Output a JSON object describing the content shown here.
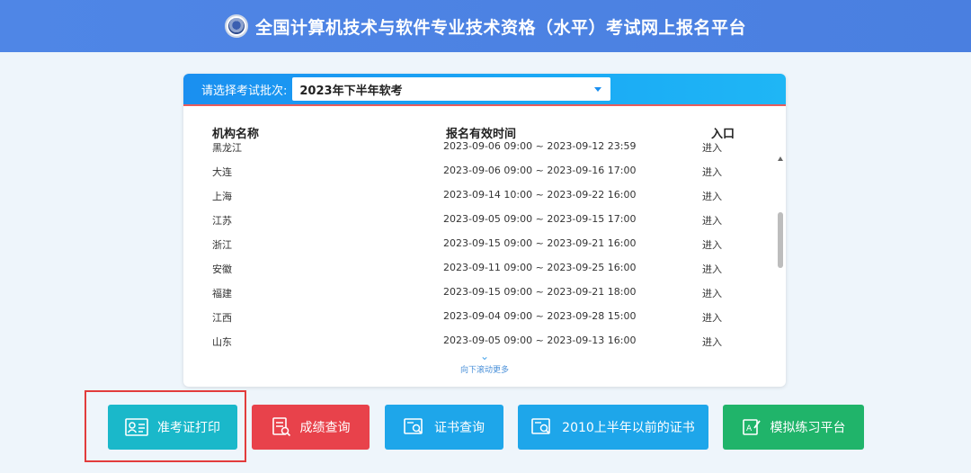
{
  "header": {
    "title": "全国计算机技术与软件专业技术资格（水平）考试网上报名平台"
  },
  "batch": {
    "label": "请选择考试批次:",
    "selected": "2023年下半年软考"
  },
  "table": {
    "headers": [
      "机构名称",
      "报名有效时间",
      "入口"
    ],
    "rows": [
      {
        "name": "黑龙江",
        "time": "2023-09-06 09:00 ~ 2023-09-12 23:59",
        "entry": "进入"
      },
      {
        "name": "大连",
        "time": "2023-09-06 09:00 ~ 2023-09-16 17:00",
        "entry": "进入"
      },
      {
        "name": "上海",
        "time": "2023-09-14 10:00 ~ 2023-09-22 16:00",
        "entry": "进入"
      },
      {
        "name": "江苏",
        "time": "2023-09-05 09:00 ~ 2023-09-15 17:00",
        "entry": "进入"
      },
      {
        "name": "浙江",
        "time": "2023-09-15 09:00 ~ 2023-09-21 16:00",
        "entry": "进入"
      },
      {
        "name": "安徽",
        "time": "2023-09-11 09:00 ~ 2023-09-25 16:00",
        "entry": "进入"
      },
      {
        "name": "福建",
        "time": "2023-09-15 09:00 ~ 2023-09-21 18:00",
        "entry": "进入"
      },
      {
        "name": "江西",
        "time": "2023-09-04 09:00 ~ 2023-09-28 15:00",
        "entry": "进入"
      },
      {
        "name": "山东",
        "time": "2023-09-05 09:00 ~ 2023-09-13 16:00",
        "entry": "进入"
      }
    ]
  },
  "scroll_more": "向下滚动更多",
  "buttons": {
    "admission": "准考证打印",
    "score": "成绩查询",
    "cert": "证书查询",
    "old_cert": "2010上半年以前的证书",
    "practice": "模拟练习平台"
  },
  "icons": [
    "id-card-icon",
    "report-search-icon",
    "certificate-search-icon",
    "certificate-search-icon",
    "practice-edit-icon"
  ]
}
